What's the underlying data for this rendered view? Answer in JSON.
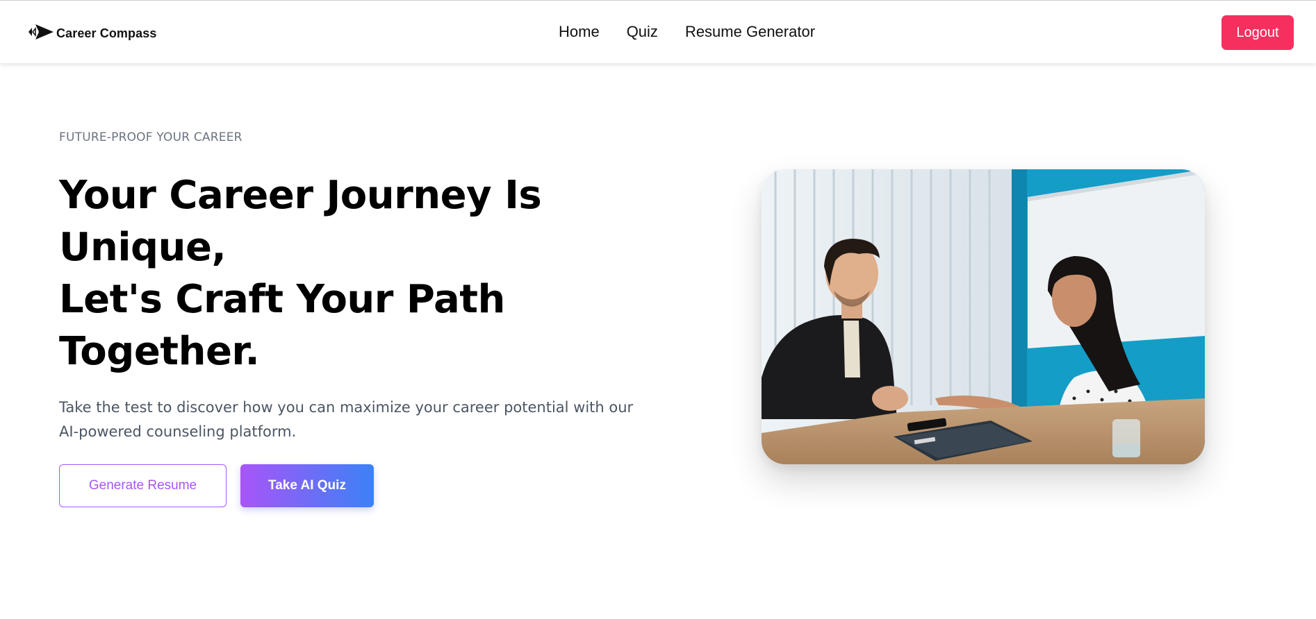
{
  "nav": {
    "brand": "Career Compass",
    "links": [
      "Home",
      "Quiz",
      "Resume Generator"
    ],
    "logout_label": "Logout"
  },
  "hero": {
    "eyebrow": "FUTURE-PROOF YOUR CAREER",
    "headline_lines": [
      "Your Career Journey Is",
      "Unique,",
      "Let's Craft Your Path",
      "Together."
    ],
    "description": "Take the test to discover how you can maximize your career potential with our AI-powered counseling platform.",
    "primary_button": "Generate Resume",
    "secondary_button": "Take AI Quiz"
  },
  "colors": {
    "logout": "#f5305f",
    "accent_purple": "#a855f7",
    "accent_blue": "#3b82f6",
    "text_muted": "#4b5563"
  },
  "icons": {
    "brand_logo": "compass-arrow-icon"
  }
}
